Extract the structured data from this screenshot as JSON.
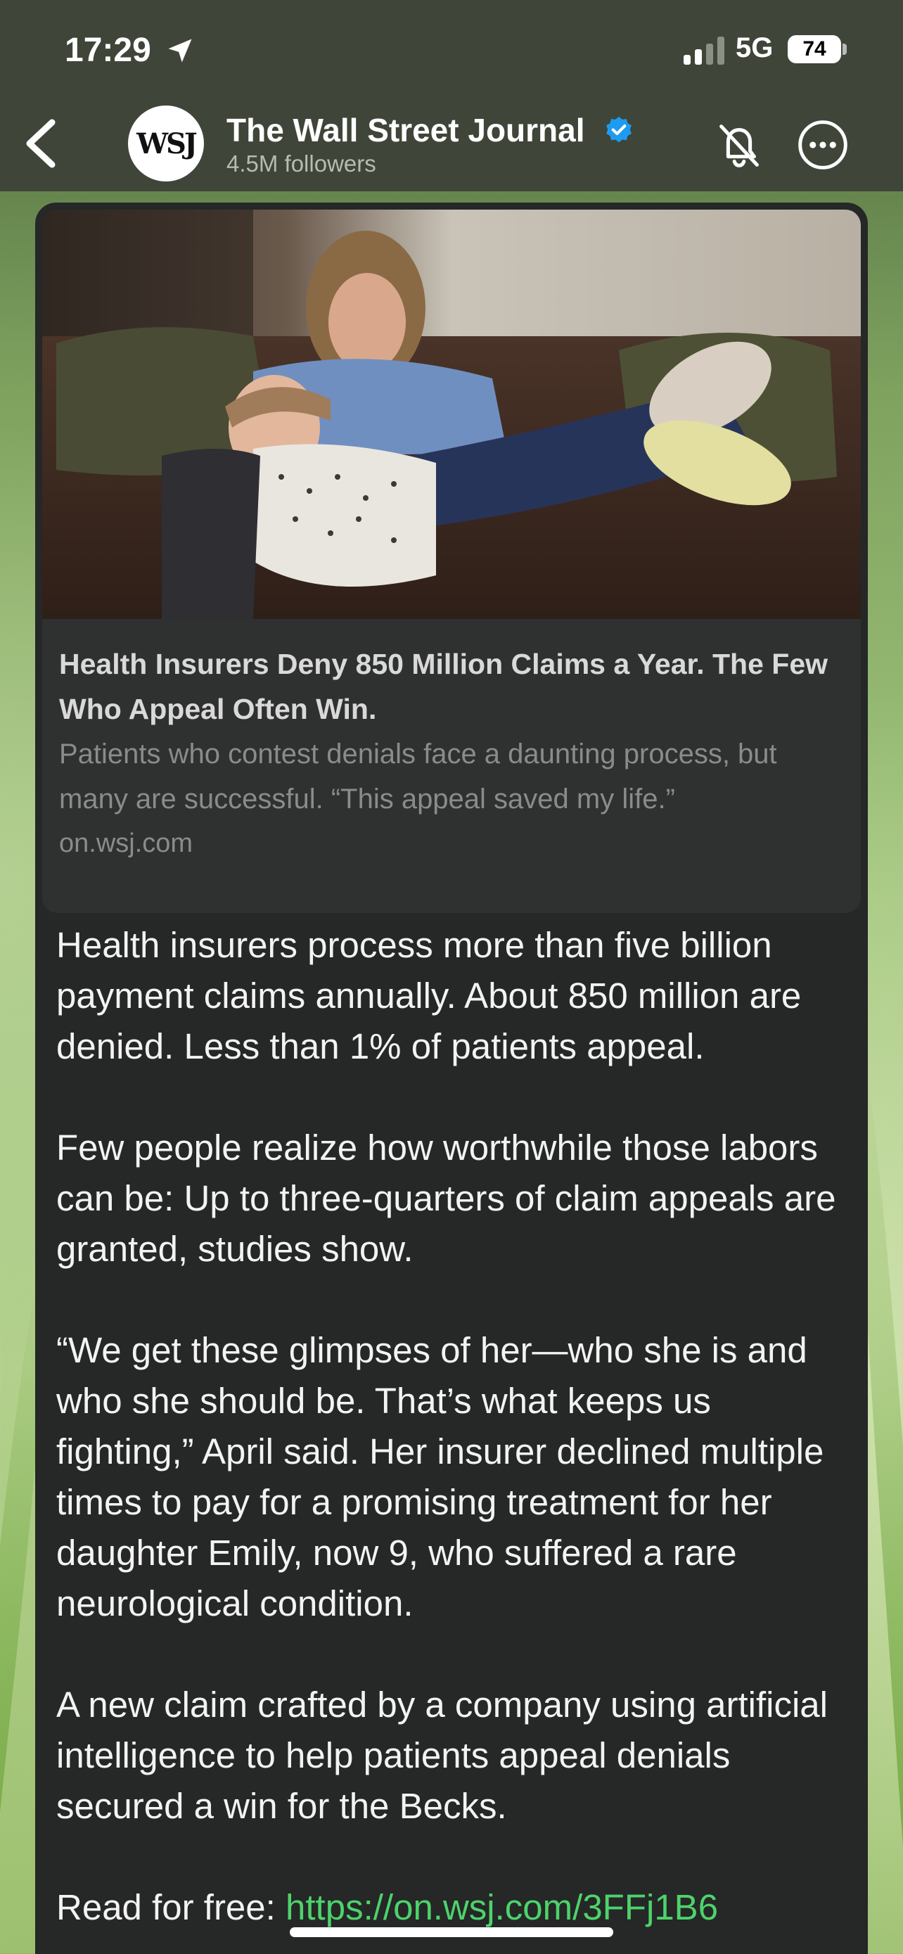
{
  "status_bar": {
    "time": "17:29",
    "network": "5G",
    "battery": "74"
  },
  "header": {
    "avatar_text": "WSJ",
    "channel_name": "The Wall Street Journal",
    "followers": "4.5M followers"
  },
  "link_preview": {
    "title": "Health Insurers Deny 850 Million Claims a Year. The Few Who Appeal Often Win.",
    "description": "Patients who contest denials face a daunting process, but many are successful. “This appeal saved my life.”",
    "domain": "on.wsj.com"
  },
  "message": {
    "paragraphs": [
      "Health insurers process more than five billion payment claims annually. About 850 million are denied. Less than 1% of patients appeal.",
      "Few people realize how worthwhile those labors can be: Up to three-quarters of claim appeals are granted, studies show.",
      "“We get these glimpses of her—who she is and who she should be. That’s what keeps us fighting,” April said. Her insurer declined multiple times to pay for a promising treatment for her daughter Emily, now 9, who suffered a rare neurological condition.",
      "A new claim crafted by a company using artificial intelligence to help patients appeal denials secured a win for the Becks."
    ],
    "read_prefix": "Read for free: ",
    "read_link": "https://on.wsj.com/3FFj1B6"
  },
  "colors": {
    "verified": "#1d9bf0",
    "link": "#4cd36b",
    "bubble": "#262727"
  },
  "icons": [
    "location-arrow-icon",
    "signal-icon",
    "battery-icon",
    "back-chevron-icon",
    "verified-badge-icon",
    "muted-bell-icon",
    "more-options-icon"
  ]
}
